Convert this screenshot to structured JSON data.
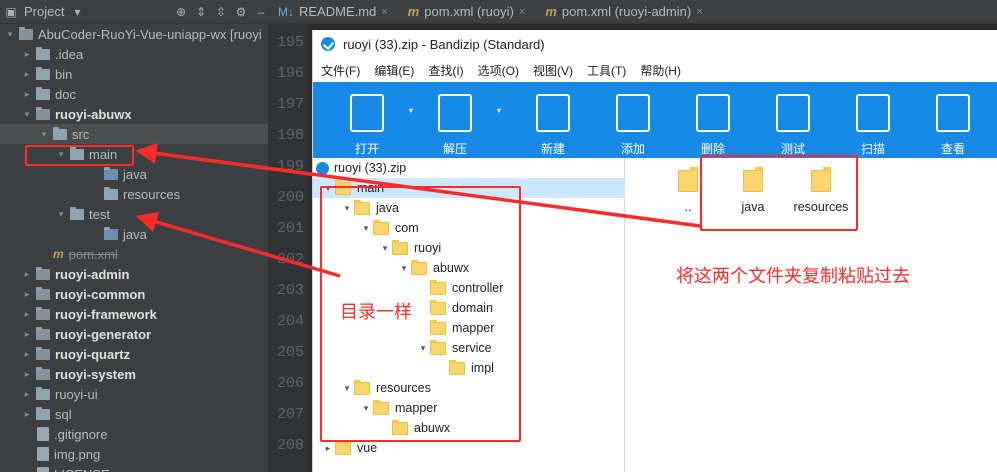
{
  "project_panel": {
    "title": "Project",
    "tree": [
      {
        "label": "AbuCoder-RuoYi-Vue-uniapp-wx [ruoyi",
        "kind": "module",
        "arrow": "▾",
        "indent": 0,
        "bold": false
      },
      {
        "label": ".idea",
        "kind": "folder",
        "arrow": "▸",
        "indent": 1,
        "bold": false
      },
      {
        "label": "bin",
        "kind": "folder",
        "arrow": "▸",
        "indent": 1,
        "bold": false
      },
      {
        "label": "doc",
        "kind": "folder",
        "arrow": "▸",
        "indent": 1,
        "bold": false
      },
      {
        "label": "ruoyi-abuwx",
        "kind": "module",
        "arrow": "▾",
        "indent": 1,
        "bold": true
      },
      {
        "label": "src",
        "kind": "folder",
        "arrow": "▾",
        "indent": 2,
        "bold": false,
        "selected": true
      },
      {
        "label": "main",
        "kind": "folder",
        "arrow": "▾",
        "indent": 3,
        "bold": false
      },
      {
        "label": "java",
        "kind": "src",
        "arrow": "",
        "indent": 5,
        "bold": false
      },
      {
        "label": "resources",
        "kind": "folder",
        "arrow": "",
        "indent": 5,
        "bold": false
      },
      {
        "label": "test",
        "kind": "folder",
        "arrow": "▾",
        "indent": 3,
        "bold": false
      },
      {
        "label": "java",
        "kind": "src",
        "arrow": "",
        "indent": 5,
        "bold": false
      },
      {
        "label": "pom.xml",
        "kind": "maven",
        "arrow": "",
        "indent": 2,
        "bold": false,
        "strike": true
      },
      {
        "label": "ruoyi-admin",
        "kind": "module",
        "arrow": "▸",
        "indent": 1,
        "bold": true
      },
      {
        "label": "ruoyi-common",
        "kind": "module",
        "arrow": "▸",
        "indent": 1,
        "bold": true
      },
      {
        "label": "ruoyi-framework",
        "kind": "module",
        "arrow": "▸",
        "indent": 1,
        "bold": true
      },
      {
        "label": "ruoyi-generator",
        "kind": "module",
        "arrow": "▸",
        "indent": 1,
        "bold": true
      },
      {
        "label": "ruoyi-quartz",
        "kind": "module",
        "arrow": "▸",
        "indent": 1,
        "bold": true
      },
      {
        "label": "ruoyi-system",
        "kind": "module",
        "arrow": "▸",
        "indent": 1,
        "bold": true
      },
      {
        "label": "ruoyi-ui",
        "kind": "folder",
        "arrow": "▸",
        "indent": 1,
        "bold": false
      },
      {
        "label": "sql",
        "kind": "folder",
        "arrow": "▸",
        "indent": 1,
        "bold": false
      },
      {
        "label": ".gitignore",
        "kind": "file",
        "arrow": "",
        "indent": 1,
        "bold": false
      },
      {
        "label": "img.png",
        "kind": "file",
        "arrow": "",
        "indent": 1,
        "bold": false
      },
      {
        "label": "LICENSE",
        "kind": "file",
        "arrow": "",
        "indent": 1,
        "bold": false
      }
    ]
  },
  "editor": {
    "tabs": [
      {
        "label": "README.md",
        "icon": "markdown-icon"
      },
      {
        "label": "pom.xml (ruoyi)",
        "icon": "maven-icon"
      },
      {
        "label": "pom.xml (ruoyi-admin)",
        "icon": "maven-icon"
      }
    ],
    "line_numbers": [
      "195",
      "196",
      "197",
      "198",
      "199",
      "200",
      "201",
      "202",
      "203",
      "204",
      "205",
      "206",
      "207",
      "208"
    ]
  },
  "bandizip": {
    "title": "ruoyi (33).zip - Bandizip (Standard)",
    "menu": [
      "文件(F)",
      "编辑(E)",
      "查找(I)",
      "选项(O)",
      "视图(V)",
      "工具(T)",
      "帮助(H)"
    ],
    "toolbar": [
      {
        "label": "打开",
        "icon": "open-icon",
        "dropdown": true
      },
      {
        "label": "解压",
        "icon": "extract-icon",
        "dropdown": true
      },
      {
        "label": "新建",
        "icon": "new-archive-icon",
        "dropdown": false
      },
      {
        "label": "添加",
        "icon": "add-file-icon",
        "dropdown": false
      },
      {
        "label": "删除",
        "icon": "delete-file-icon",
        "dropdown": false
      },
      {
        "label": "测试",
        "icon": "test-icon",
        "dropdown": false
      },
      {
        "label": "扫描",
        "icon": "scan-shield-icon",
        "dropdown": false
      },
      {
        "label": "查看",
        "icon": "view-list-icon",
        "dropdown": false
      }
    ],
    "archive_root": "ruoyi (33).zip",
    "tree": [
      {
        "label": "main",
        "arrow": "▾",
        "indent": 0,
        "selected": true
      },
      {
        "label": "java",
        "arrow": "▾",
        "indent": 1
      },
      {
        "label": "com",
        "arrow": "▾",
        "indent": 2
      },
      {
        "label": "ruoyi",
        "arrow": "▾",
        "indent": 3
      },
      {
        "label": "abuwx",
        "arrow": "▾",
        "indent": 4
      },
      {
        "label": "controller",
        "arrow": "",
        "indent": 5
      },
      {
        "label": "domain",
        "arrow": "",
        "indent": 5
      },
      {
        "label": "mapper",
        "arrow": "",
        "indent": 5
      },
      {
        "label": "service",
        "arrow": "▾",
        "indent": 5
      },
      {
        "label": "impl",
        "arrow": "",
        "indent": 6
      },
      {
        "label": "resources",
        "arrow": "▾",
        "indent": 1
      },
      {
        "label": "mapper",
        "arrow": "▾",
        "indent": 2
      },
      {
        "label": "abuwx",
        "arrow": "",
        "indent": 3
      },
      {
        "label": "vue",
        "arrow": "▸",
        "indent": 0
      }
    ],
    "files": [
      {
        "label": ".."
      },
      {
        "label": "java"
      },
      {
        "label": "resources"
      }
    ]
  },
  "annotations": {
    "same_structure": "目录一样",
    "copy_instruction": "将这两个文件夹复制粘贴过去"
  },
  "colors": {
    "annotation_red": "#ff2a2a",
    "toolbar_blue": "#1789e6",
    "folder_yellow": "#f8d66c"
  }
}
